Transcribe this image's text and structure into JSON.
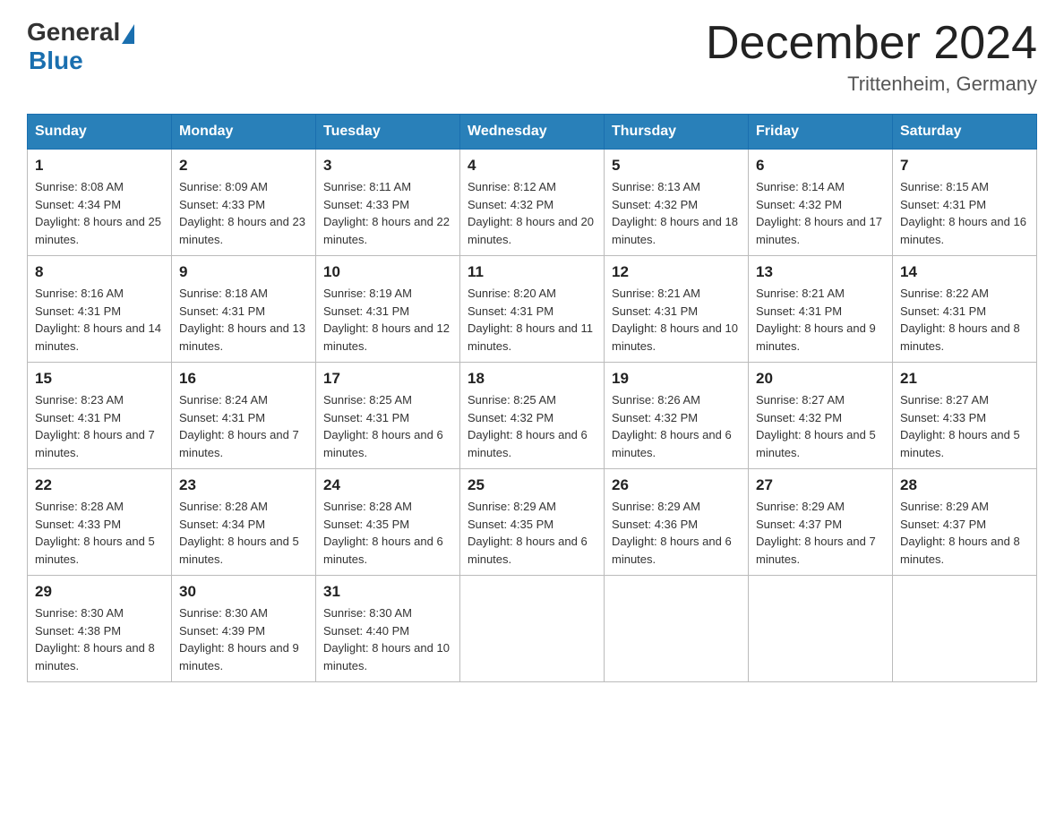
{
  "logo": {
    "general": "General",
    "blue": "Blue"
  },
  "header": {
    "month_title": "December 2024",
    "location": "Trittenheim, Germany"
  },
  "weekdays": [
    "Sunday",
    "Monday",
    "Tuesday",
    "Wednesday",
    "Thursday",
    "Friday",
    "Saturday"
  ],
  "weeks": [
    [
      {
        "day": "1",
        "sunrise": "8:08 AM",
        "sunset": "4:34 PM",
        "daylight": "8 hours and 25 minutes."
      },
      {
        "day": "2",
        "sunrise": "8:09 AM",
        "sunset": "4:33 PM",
        "daylight": "8 hours and 23 minutes."
      },
      {
        "day": "3",
        "sunrise": "8:11 AM",
        "sunset": "4:33 PM",
        "daylight": "8 hours and 22 minutes."
      },
      {
        "day": "4",
        "sunrise": "8:12 AM",
        "sunset": "4:32 PM",
        "daylight": "8 hours and 20 minutes."
      },
      {
        "day": "5",
        "sunrise": "8:13 AM",
        "sunset": "4:32 PM",
        "daylight": "8 hours and 18 minutes."
      },
      {
        "day": "6",
        "sunrise": "8:14 AM",
        "sunset": "4:32 PM",
        "daylight": "8 hours and 17 minutes."
      },
      {
        "day": "7",
        "sunrise": "8:15 AM",
        "sunset": "4:31 PM",
        "daylight": "8 hours and 16 minutes."
      }
    ],
    [
      {
        "day": "8",
        "sunrise": "8:16 AM",
        "sunset": "4:31 PM",
        "daylight": "8 hours and 14 minutes."
      },
      {
        "day": "9",
        "sunrise": "8:18 AM",
        "sunset": "4:31 PM",
        "daylight": "8 hours and 13 minutes."
      },
      {
        "day": "10",
        "sunrise": "8:19 AM",
        "sunset": "4:31 PM",
        "daylight": "8 hours and 12 minutes."
      },
      {
        "day": "11",
        "sunrise": "8:20 AM",
        "sunset": "4:31 PM",
        "daylight": "8 hours and 11 minutes."
      },
      {
        "day": "12",
        "sunrise": "8:21 AM",
        "sunset": "4:31 PM",
        "daylight": "8 hours and 10 minutes."
      },
      {
        "day": "13",
        "sunrise": "8:21 AM",
        "sunset": "4:31 PM",
        "daylight": "8 hours and 9 minutes."
      },
      {
        "day": "14",
        "sunrise": "8:22 AM",
        "sunset": "4:31 PM",
        "daylight": "8 hours and 8 minutes."
      }
    ],
    [
      {
        "day": "15",
        "sunrise": "8:23 AM",
        "sunset": "4:31 PM",
        "daylight": "8 hours and 7 minutes."
      },
      {
        "day": "16",
        "sunrise": "8:24 AM",
        "sunset": "4:31 PM",
        "daylight": "8 hours and 7 minutes."
      },
      {
        "day": "17",
        "sunrise": "8:25 AM",
        "sunset": "4:31 PM",
        "daylight": "8 hours and 6 minutes."
      },
      {
        "day": "18",
        "sunrise": "8:25 AM",
        "sunset": "4:32 PM",
        "daylight": "8 hours and 6 minutes."
      },
      {
        "day": "19",
        "sunrise": "8:26 AM",
        "sunset": "4:32 PM",
        "daylight": "8 hours and 6 minutes."
      },
      {
        "day": "20",
        "sunrise": "8:27 AM",
        "sunset": "4:32 PM",
        "daylight": "8 hours and 5 minutes."
      },
      {
        "day": "21",
        "sunrise": "8:27 AM",
        "sunset": "4:33 PM",
        "daylight": "8 hours and 5 minutes."
      }
    ],
    [
      {
        "day": "22",
        "sunrise": "8:28 AM",
        "sunset": "4:33 PM",
        "daylight": "8 hours and 5 minutes."
      },
      {
        "day": "23",
        "sunrise": "8:28 AM",
        "sunset": "4:34 PM",
        "daylight": "8 hours and 5 minutes."
      },
      {
        "day": "24",
        "sunrise": "8:28 AM",
        "sunset": "4:35 PM",
        "daylight": "8 hours and 6 minutes."
      },
      {
        "day": "25",
        "sunrise": "8:29 AM",
        "sunset": "4:35 PM",
        "daylight": "8 hours and 6 minutes."
      },
      {
        "day": "26",
        "sunrise": "8:29 AM",
        "sunset": "4:36 PM",
        "daylight": "8 hours and 6 minutes."
      },
      {
        "day": "27",
        "sunrise": "8:29 AM",
        "sunset": "4:37 PM",
        "daylight": "8 hours and 7 minutes."
      },
      {
        "day": "28",
        "sunrise": "8:29 AM",
        "sunset": "4:37 PM",
        "daylight": "8 hours and 8 minutes."
      }
    ],
    [
      {
        "day": "29",
        "sunrise": "8:30 AM",
        "sunset": "4:38 PM",
        "daylight": "8 hours and 8 minutes."
      },
      {
        "day": "30",
        "sunrise": "8:30 AM",
        "sunset": "4:39 PM",
        "daylight": "8 hours and 9 minutes."
      },
      {
        "day": "31",
        "sunrise": "8:30 AM",
        "sunset": "4:40 PM",
        "daylight": "8 hours and 10 minutes."
      },
      null,
      null,
      null,
      null
    ]
  ]
}
